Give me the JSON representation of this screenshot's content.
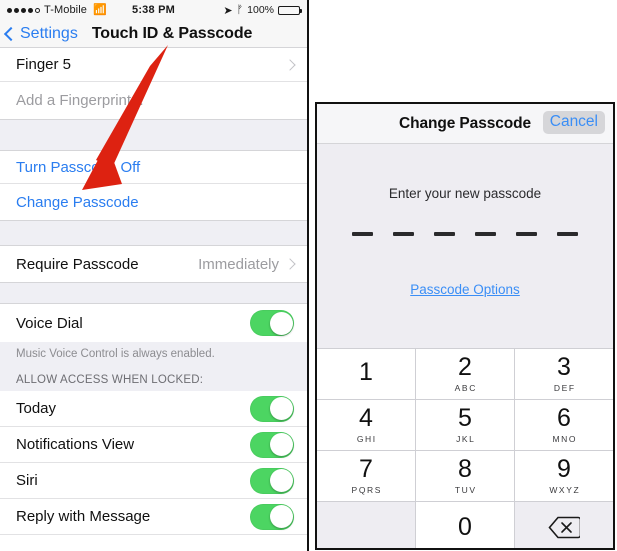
{
  "left_panel": {
    "status_bar": {
      "signal_dots_filled": 4,
      "signal_dots_total": 5,
      "carrier": "T-Mobile",
      "wifi_icon": "wifi-icon",
      "time": "5:38 PM",
      "location_icon": "location-arrow-icon",
      "bluetooth_icon": "bluetooth-icon",
      "battery_percent": "100%"
    },
    "nav": {
      "back_label": "Settings",
      "title": "Touch ID & Passcode"
    },
    "rows": {
      "finger5": "Finger 5",
      "add_fingerprint": "Add a Fingerprint...",
      "turn_passcode_off": "Turn Passcode Off",
      "change_passcode": "Change Passcode",
      "require_passcode_label": "Require Passcode",
      "require_passcode_value": "Immediately",
      "voice_dial": "Voice Dial",
      "voice_dial_footnote": "Music Voice Control is always enabled.",
      "allow_access_header": "ALLOW ACCESS WHEN LOCKED:",
      "today": "Today",
      "notifications_view": "Notifications View",
      "siri": "Siri",
      "reply_with_message": "Reply with Message"
    },
    "annotation": {
      "type": "red-arrow",
      "color": "#dd2211",
      "points_to": "Change Passcode"
    }
  },
  "right_panel": {
    "title": "Change Passcode",
    "cancel_label": "Cancel",
    "prompt": "Enter your new passcode",
    "passcode_slots": 6,
    "passcode_entered": 0,
    "options_link": "Passcode Options",
    "keypad": [
      {
        "num": "1",
        "letters": ""
      },
      {
        "num": "2",
        "letters": "ABC"
      },
      {
        "num": "3",
        "letters": "DEF"
      },
      {
        "num": "4",
        "letters": "GHI"
      },
      {
        "num": "5",
        "letters": "JKL"
      },
      {
        "num": "6",
        "letters": "MNO"
      },
      {
        "num": "7",
        "letters": "PQRS"
      },
      {
        "num": "8",
        "letters": "TUV"
      },
      {
        "num": "9",
        "letters": "WXYZ"
      },
      {
        "num": "",
        "letters": ""
      },
      {
        "num": "0",
        "letters": ""
      },
      {
        "num": "delete-icon",
        "letters": ""
      }
    ]
  },
  "colors": {
    "ios_blue": "#2a7df0",
    "toggle_green": "#4cd562",
    "annotation_red": "#dd2211",
    "group_bg": "#efeff4"
  }
}
